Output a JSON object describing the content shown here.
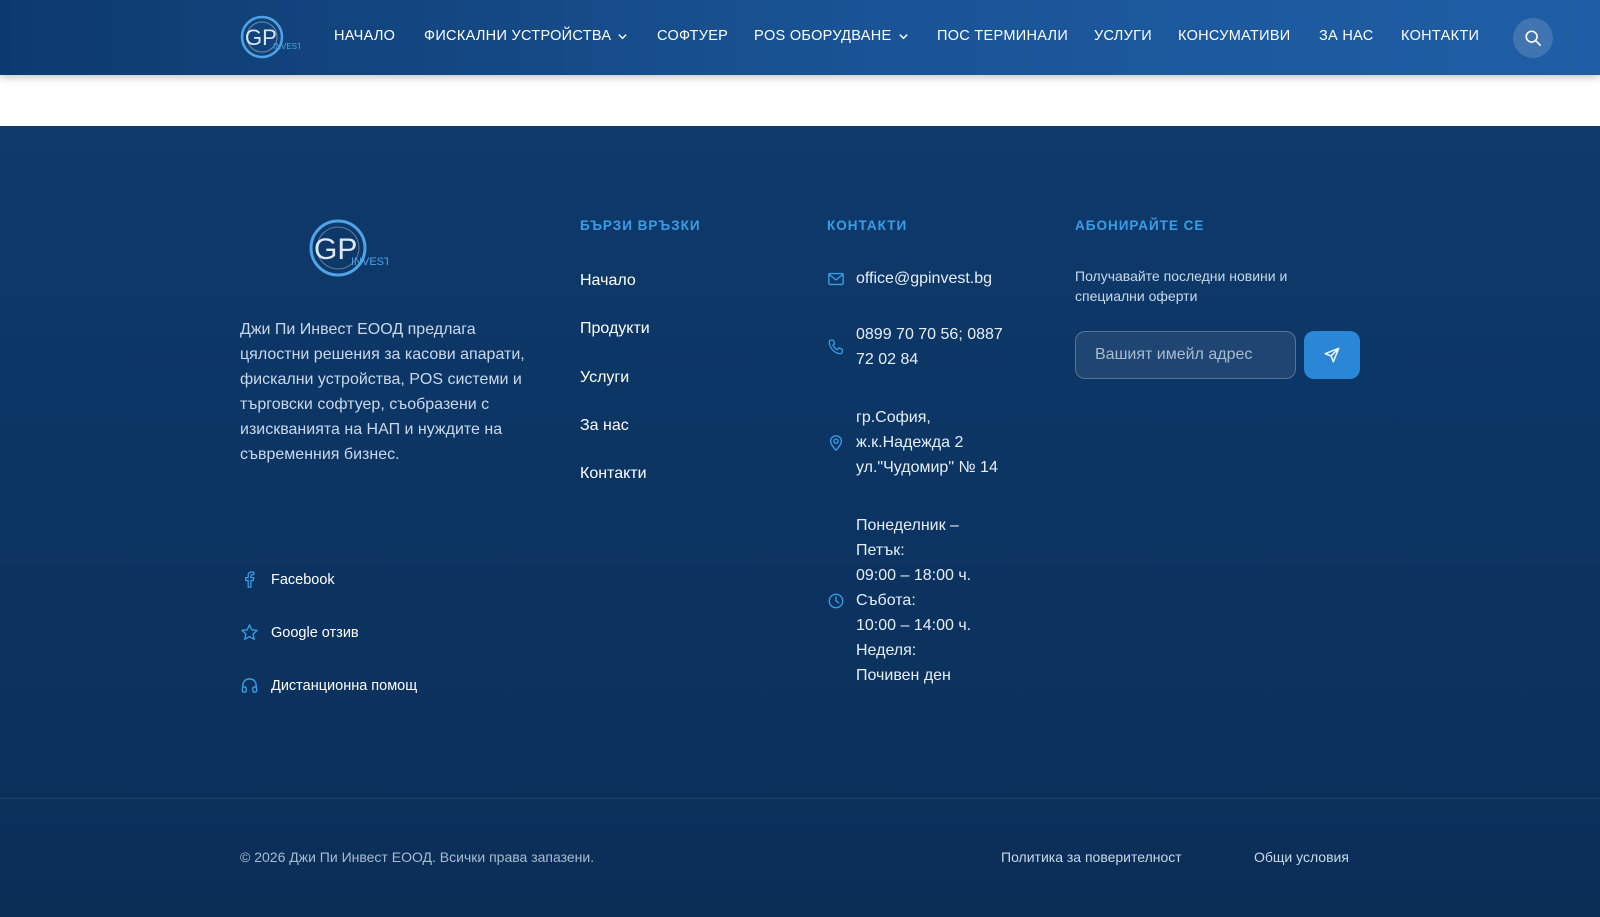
{
  "header": {
    "logo_alt": "GP INVEST",
    "nav": [
      {
        "label": "НАЧАЛО",
        "has_dropdown": false
      },
      {
        "label": "ФИСКАЛНИ УСТРОЙСТВА",
        "has_dropdown": true
      },
      {
        "label": "СОФТУЕР",
        "has_dropdown": false
      },
      {
        "label": "POS ОБОРУДВАНЕ",
        "has_dropdown": true
      },
      {
        "label": "ПОС ТЕРМИНАЛИ",
        "has_dropdown": false
      },
      {
        "label": "УСЛУГИ",
        "has_dropdown": false
      },
      {
        "label": "КОНСУМАТИВИ",
        "has_dropdown": false
      },
      {
        "label": "ЗА НАС",
        "has_dropdown": false
      },
      {
        "label": "КОНТАКТИ",
        "has_dropdown": false
      }
    ],
    "search_icon": "search-icon"
  },
  "footer": {
    "about": "Джи Пи Инвест ЕООД предлага цялостни решения за касови апарати, фискални устройства, POS системи и търговски софтуер, съобразени с изискванията на НАП и нуждите на съвременния бизнес.",
    "social": [
      {
        "label": "Facebook",
        "icon": "facebook-icon"
      },
      {
        "label": "Google отзив",
        "icon": "star-icon"
      },
      {
        "label": "Дистанционна помощ",
        "icon": "headphones-icon"
      }
    ],
    "quick_links": {
      "title": "БЪРЗИ ВРЪЗКИ",
      "items": [
        "Начало",
        "Продукти",
        "Услуги",
        "За нас",
        "Контакти"
      ]
    },
    "contacts": {
      "title": "КОНТАКТИ",
      "email": "office@gpinvest.bg",
      "phone_line1": "0899 70 70 56; 0887",
      "phone_line2": "72 02 84",
      "address_line1": "гр.София,",
      "address_line2": "ж.к.Надежда 2",
      "address_line3": "ул.\"Чудомир\" № 14",
      "hours": [
        "Понеделник –",
        "Петък:",
        "09:00 – 18:00 ч.",
        "Събота:",
        "10:00 – 14:00 ч.",
        "Неделя:",
        "Почивен ден"
      ]
    },
    "subscribe": {
      "title": "АБОНИРАЙТЕ СЕ",
      "text": "Получавайте последни новини и специални оферти",
      "placeholder": "Вашият имейл адрес",
      "send_icon": "send-icon"
    },
    "copyright": "© 2026 Джи Пи Инвест ЕООД. Всички права запазени.",
    "legal": [
      "Политика за поверителност",
      "Общи условия"
    ]
  },
  "colors": {
    "header_bg": "#1a5496",
    "footer_bg": "#0c3564",
    "accent": "#3a9ee6",
    "button": "#2a86d6"
  }
}
